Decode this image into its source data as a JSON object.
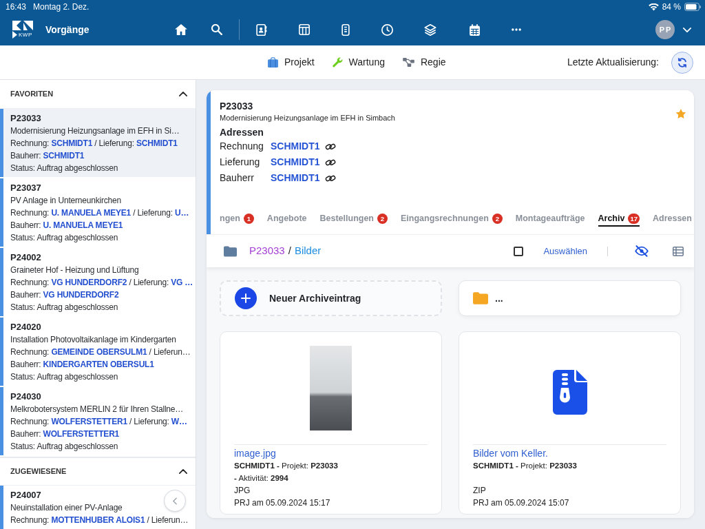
{
  "status_bar": {
    "time": "16:43",
    "date": "Montag 2. Dez.",
    "battery": "84 %"
  },
  "nav": {
    "logo_text": "KWP",
    "title": "Vorgänge",
    "avatar": "PP"
  },
  "toolbar": {
    "modes": [
      {
        "kind": "project",
        "label": "Projekt"
      },
      {
        "kind": "maintenance",
        "label": "Wartung"
      },
      {
        "kind": "regie",
        "label": "Regie"
      }
    ],
    "last_update_label": "Letzte Aktualisierung:"
  },
  "sidebar": {
    "sections": [
      {
        "title": "FAVORITEN",
        "expanded": true,
        "items": [
          {
            "id": "P23033",
            "title": "Modernisierung Heizungsanlage im EFH in Si…",
            "billing": "Rechnung: **SCHMIDT1** / Lieferung: **SCHMIDT1**",
            "owner": "Bauherr: **SCHMIDT1**",
            "status": "Status: Auftrag abgeschlossen",
            "selected": true
          },
          {
            "id": "P23037",
            "title": "PV Anlage in Unterneunkirchen",
            "billing": "Rechnung: **U. MANUELA MEYE1** / Lieferung: **U…**",
            "owner": "Bauherr: **U. MANUELA MEYE1**",
            "status": "Status: Auftrag abgeschlossen",
            "selected": false
          },
          {
            "id": "P24002",
            "title": "Graineter Hof - Heizung und Lüftung",
            "billing": "Rechnung: **VG HUNDERDORF2** / Lieferung: **VG …**",
            "owner": "Bauherr: **VG HUNDERDORF2**",
            "status": "Status: Auftrag abgeschlossen",
            "selected": false
          },
          {
            "id": "P24020",
            "title": "Installation Photovoltaikanlage im Kindergarten",
            "billing": "Rechnung: **GEMEINDE OBERSULM1** / Lieferun…",
            "owner": "Bauherr: **KINDERGARTEN OBERSUL1**",
            "status": "Status: Auftrag abgeschlossen",
            "selected": false
          },
          {
            "id": "P24030",
            "title": "Melkrobotersystem MERLIN 2 für Ihren Stallne…",
            "billing": "Rechnung: **WOLFERSTETTER1** / Lieferung: **W…**",
            "owner": "Bauherr: **WOLFERSTETTER1**",
            "status": "Status: Auftrag abgeschlossen",
            "selected": false
          }
        ]
      },
      {
        "title": "ZUGEWIESENE",
        "expanded": true,
        "items": [
          {
            "id": "P24007",
            "title": "Neuinstallation einer PV-Anlage",
            "billing": "Rechnung: **MOTTENHUBER ALOIS1** / Lieferun…",
            "selected": false
          }
        ]
      }
    ]
  },
  "detail": {
    "id": "P23033",
    "title": "Modernisierung Heizungsanlage im EFH in Simbach",
    "favorite": true,
    "addresses_title": "Adressen",
    "addresses": [
      {
        "label": "Rechnung",
        "value": "SCHMIDT1"
      },
      {
        "label": "Lieferung",
        "value": "SCHMIDT1"
      },
      {
        "label": "Bauherr",
        "value": "SCHMIDT1"
      }
    ],
    "tabs": [
      {
        "label": "ngen",
        "badge": "1",
        "selected": false
      },
      {
        "label": "Angebote",
        "selected": false
      },
      {
        "label": "Bestellungen",
        "badge": "2",
        "selected": false
      },
      {
        "label": "Eingangsrechnungen",
        "badge": "2",
        "selected": false
      },
      {
        "label": "Montageaufträge",
        "selected": false
      },
      {
        "label": "Archiv",
        "badge": "17",
        "selected": true
      },
      {
        "label": "Adressen",
        "selected": false
      }
    ]
  },
  "folder_bar": {
    "project": "P23033",
    "separator": "/",
    "folder": "Bilder",
    "select": {
      "label": "Auswählen",
      "checked": false
    }
  },
  "archive": {
    "tiles": [
      {
        "kind": "new",
        "label": "Neuer Archiveintrag"
      },
      {
        "kind": "folder",
        "label": "..."
      }
    ],
    "files": [
      {
        "kind": "image",
        "name": "image.jpg",
        "meta": [
          "**SCHMIDT1 -** Projekt: **P23033**",
          "**-** Aktivität: **2994**"
        ],
        "type": "JPG",
        "created": "PRJ am 05.09.2024 15:17"
      },
      {
        "kind": "zip",
        "name": "Bilder vom Keller.",
        "meta": [
          "**SCHMIDT1 -** Projekt: **P23033**"
        ],
        "type": "ZIP",
        "created": "PRJ am 05.09.2024 15:07"
      }
    ]
  }
}
